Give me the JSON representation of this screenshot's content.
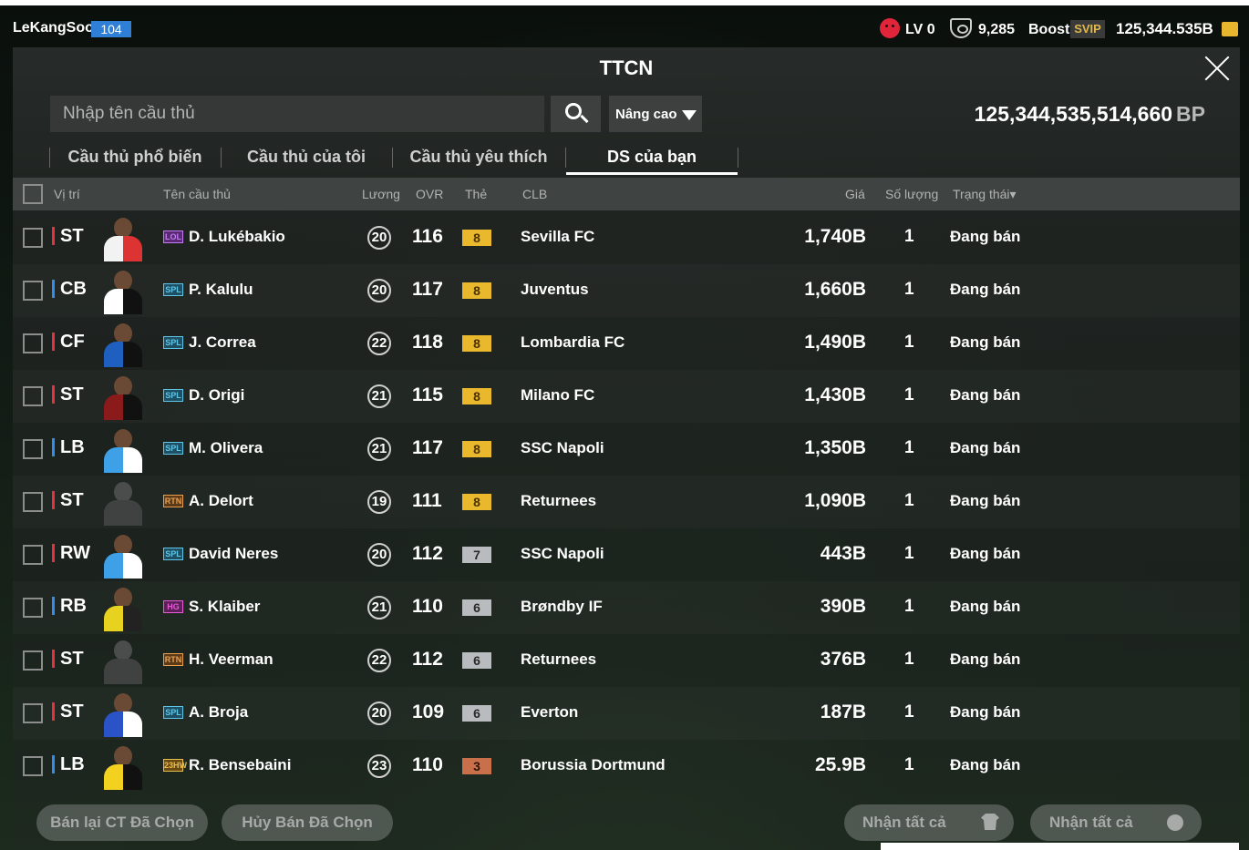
{
  "status_bar": {
    "username": "LeKangSoo",
    "level": "104",
    "lv_text": "LV 0",
    "points": "9,285",
    "boost_label": "Boost",
    "svip_label": "SVIP",
    "coins": "125,344.535B"
  },
  "header": {
    "title": "TTCN"
  },
  "search": {
    "placeholder": "Nhập tên cầu thủ",
    "advanced_label": "Nâng cao"
  },
  "balance": {
    "amount": "125,344,535,514,660",
    "unit": "BP"
  },
  "tabs": [
    {
      "label": "Cầu thủ phổ biến"
    },
    {
      "label": "Cầu thủ của tôi"
    },
    {
      "label": "Cầu thủ yêu thích"
    },
    {
      "label": "DS của bạn",
      "active": true
    }
  ],
  "columns": {
    "position": "Vị trí",
    "name": "Tên cầu thủ",
    "salary": "Lương",
    "ovr": "OVR",
    "card": "Thẻ",
    "club": "CLB",
    "price": "Giá",
    "quantity": "Số lượng",
    "status": "Trạng thái▾"
  },
  "rows": [
    {
      "pos": "ST",
      "season": "LOL",
      "name": "D. Lukébakio",
      "salary": "20",
      "ovr": "116",
      "grade": "8",
      "club": "Sevilla FC",
      "price": "1,740B",
      "qty": "1",
      "status": "Đang bán"
    },
    {
      "pos": "CB",
      "season": "SPL",
      "name": "P. Kalulu",
      "salary": "20",
      "ovr": "117",
      "grade": "8",
      "club": "Juventus",
      "price": "1,660B",
      "qty": "1",
      "status": "Đang bán"
    },
    {
      "pos": "CF",
      "season": "SPL",
      "name": "J. Correa",
      "salary": "22",
      "ovr": "118",
      "grade": "8",
      "club": "Lombardia FC",
      "price": "1,490B",
      "qty": "1",
      "status": "Đang bán"
    },
    {
      "pos": "ST",
      "season": "SPL",
      "name": "D. Origi",
      "salary": "21",
      "ovr": "115",
      "grade": "8",
      "club": "Milano FC",
      "price": "1,430B",
      "qty": "1",
      "status": "Đang bán"
    },
    {
      "pos": "LB",
      "season": "SPL",
      "name": "M. Olivera",
      "salary": "21",
      "ovr": "117",
      "grade": "8",
      "club": "SSC Napoli",
      "price": "1,350B",
      "qty": "1",
      "status": "Đang bán"
    },
    {
      "pos": "ST",
      "season": "RTN",
      "name": "A. Delort",
      "salary": "19",
      "ovr": "111",
      "grade": "8",
      "club": "Returnees",
      "price": "1,090B",
      "qty": "1",
      "status": "Đang bán"
    },
    {
      "pos": "RW",
      "season": "SPL",
      "name": "David Neres",
      "salary": "20",
      "ovr": "112",
      "grade": "7",
      "club": "SSC Napoli",
      "price": "443B",
      "qty": "1",
      "status": "Đang bán"
    },
    {
      "pos": "RB",
      "season": "HG",
      "name": "S. Klaiber",
      "salary": "21",
      "ovr": "110",
      "grade": "6",
      "club": "Brøndby IF",
      "price": "390B",
      "qty": "1",
      "status": "Đang bán"
    },
    {
      "pos": "ST",
      "season": "RTN",
      "name": "H. Veerman",
      "salary": "22",
      "ovr": "112",
      "grade": "6",
      "club": "Returnees",
      "price": "376B",
      "qty": "1",
      "status": "Đang bán"
    },
    {
      "pos": "ST",
      "season": "SPL",
      "name": "A. Broja",
      "salary": "20",
      "ovr": "109",
      "grade": "6",
      "club": "Everton",
      "price": "187B",
      "qty": "1",
      "status": "Đang bán"
    },
    {
      "pos": "LB",
      "season": "23HW",
      "name": "R. Bensebaini",
      "salary": "23",
      "ovr": "110",
      "grade": "3",
      "club": "Borussia Dortmund",
      "price": "25.9B",
      "qty": "1",
      "status": "Đang bán"
    }
  ],
  "footer": {
    "resell_label": "Bán lại CT Đã Chọn",
    "cancel_label": "Hủy Bán Đã Chọn",
    "claim_all_items_label": "Nhận tất cả",
    "claim_all_bp_label": "Nhận tất cả"
  }
}
